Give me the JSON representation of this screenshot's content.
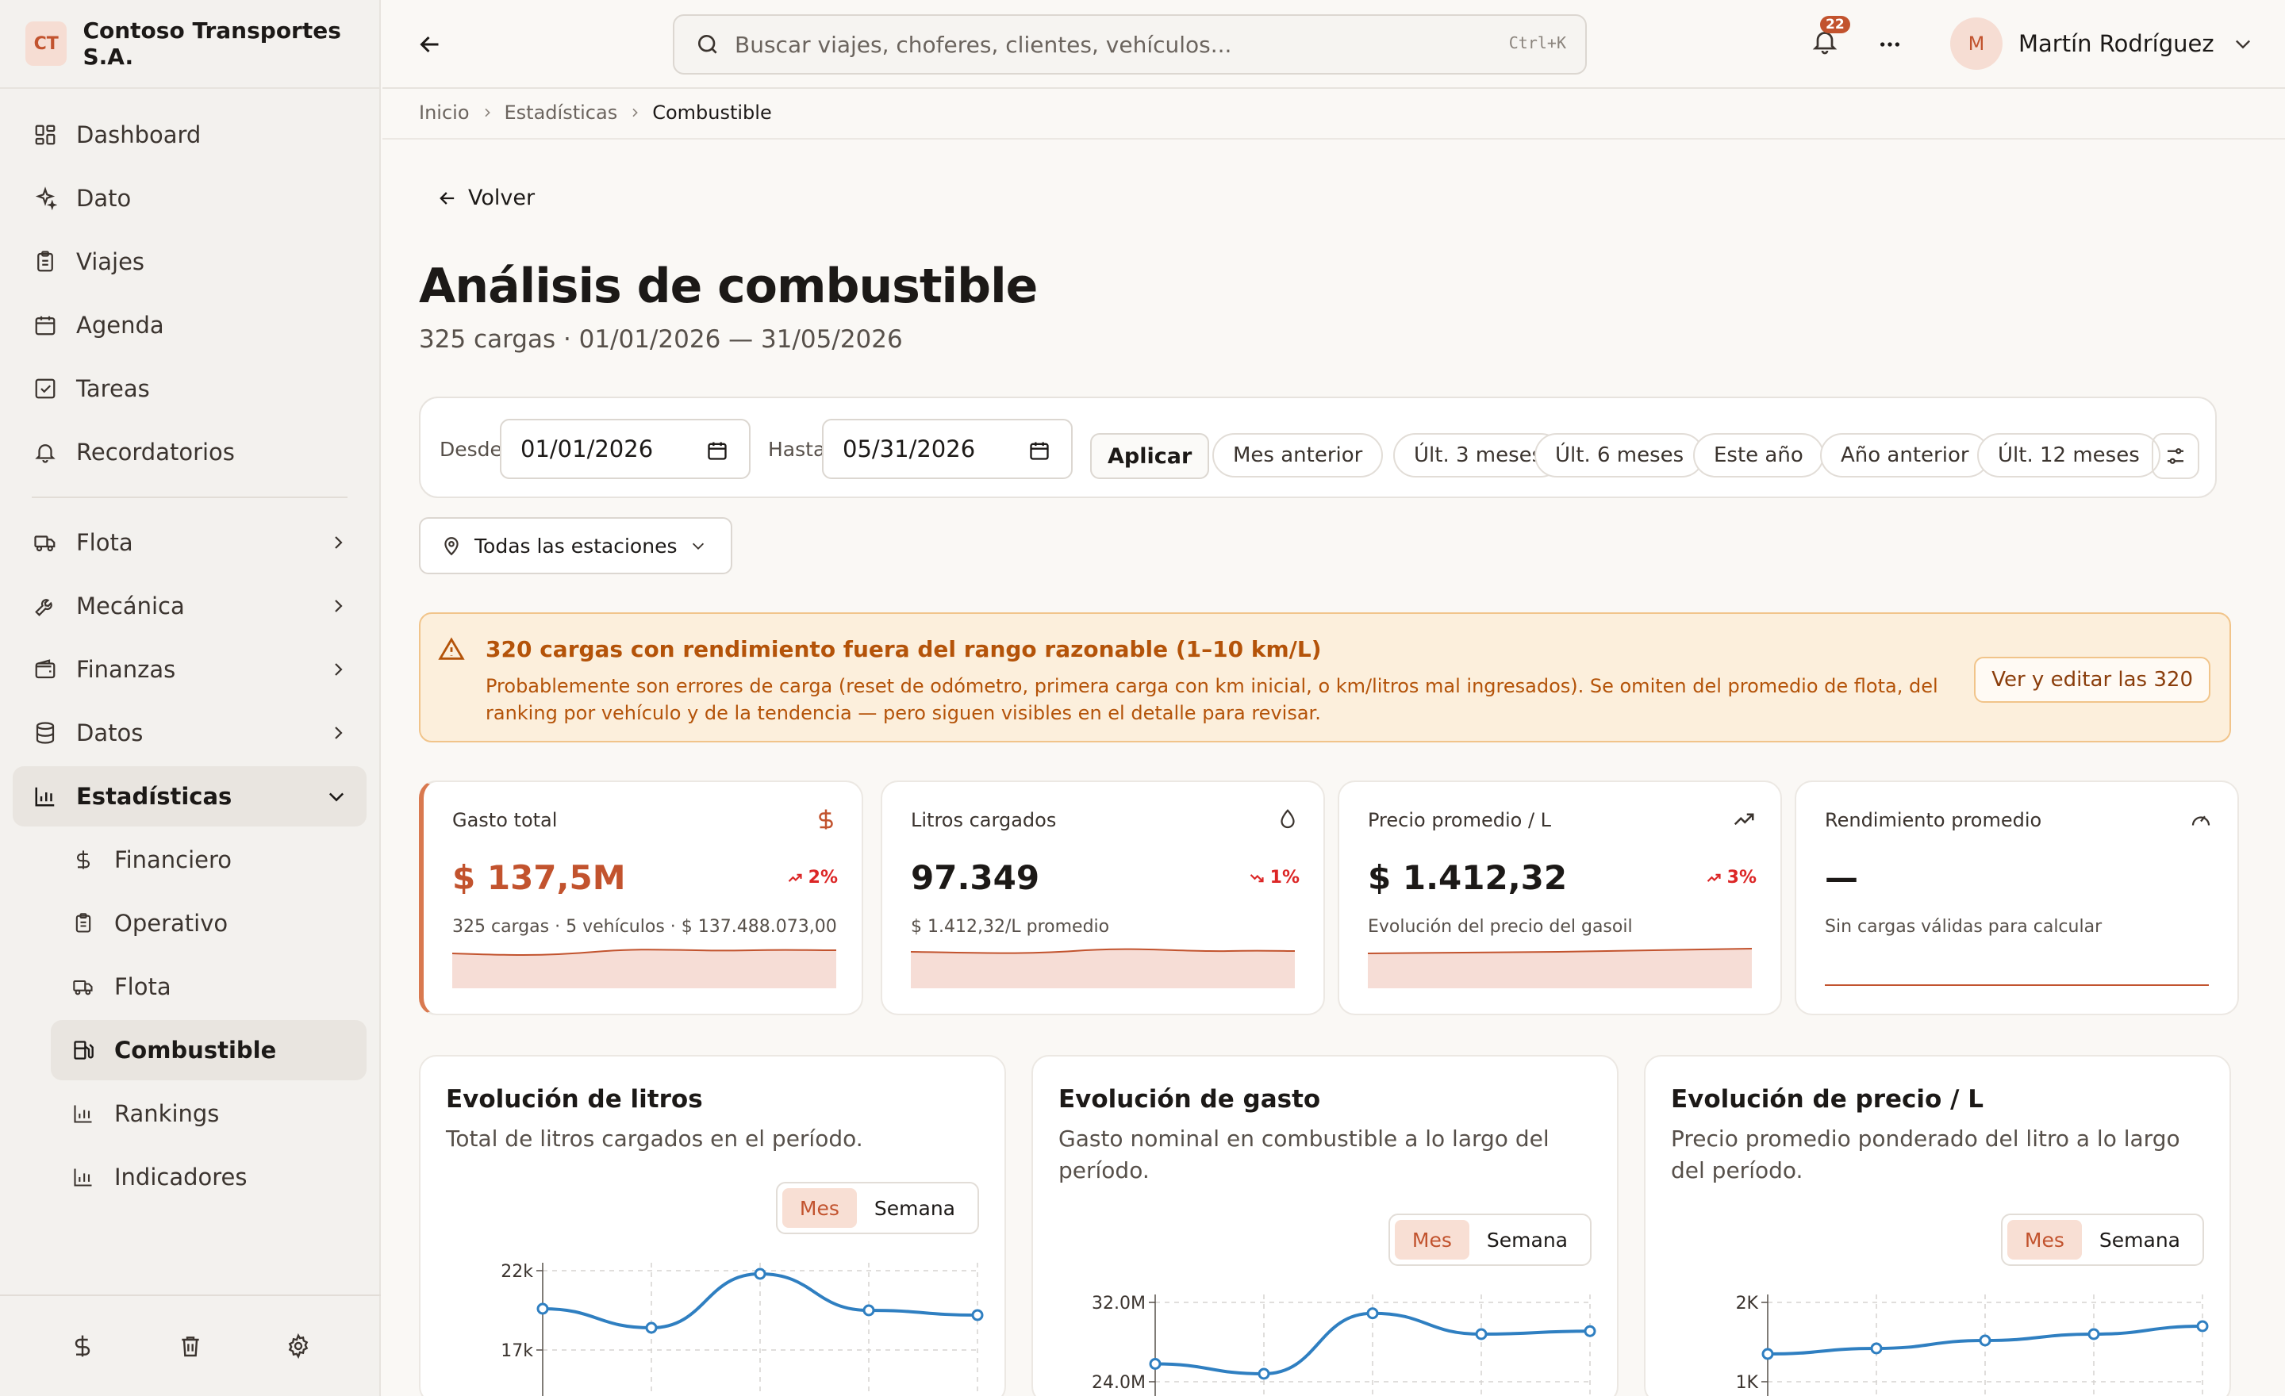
{
  "brand": {
    "logo": "CT",
    "name": "Contoso Transportes S.A."
  },
  "sidebar": {
    "items": [
      {
        "label": "Dashboard",
        "icon": "dashboard-icon"
      },
      {
        "label": "Dato",
        "icon": "sparkle-icon"
      },
      {
        "label": "Viajes",
        "icon": "clipboard-icon"
      },
      {
        "label": "Agenda",
        "icon": "calendar-icon"
      },
      {
        "label": "Tareas",
        "icon": "check-square-icon"
      },
      {
        "label": "Recordatorios",
        "icon": "bell-icon"
      }
    ],
    "groups": [
      {
        "label": "Flota",
        "icon": "truck-icon"
      },
      {
        "label": "Mecánica",
        "icon": "wrench-icon"
      },
      {
        "label": "Finanzas",
        "icon": "wallet-icon"
      },
      {
        "label": "Datos",
        "icon": "database-icon"
      },
      {
        "label": "Estadísticas",
        "icon": "bar-chart-icon"
      }
    ],
    "subitems": [
      {
        "label": "Financiero",
        "icon": "dollar-icon"
      },
      {
        "label": "Operativo",
        "icon": "clipboard-icon"
      },
      {
        "label": "Flota",
        "icon": "truck-icon"
      },
      {
        "label": "Combustible",
        "icon": "fuel-icon"
      },
      {
        "label": "Rankings",
        "icon": "bar-chart-icon"
      },
      {
        "label": "Indicadores",
        "icon": "bar-chart-icon"
      }
    ]
  },
  "topbar": {
    "search_placeholder": "Buscar viajes, choferes, clientes, vehículos...",
    "shortcut": "Ctrl+K",
    "notifications": "22",
    "user_initial": "M",
    "user_name": "Martín Rodríguez"
  },
  "breadcrumb": [
    "Inicio",
    "Estadísticas",
    "Combustible"
  ],
  "back_label": "Volver",
  "page": {
    "title": "Análisis de combustible",
    "subtitle": "325 cargas · 01/01/2026 — 31/05/2026"
  },
  "filters": {
    "from_label": "Desde",
    "from_value": "01/01/2026",
    "to_label": "Hasta",
    "to_value": "05/31/2026",
    "apply": "Aplicar",
    "chips": [
      "Mes anterior",
      "Últ. 3 meses",
      "Últ. 6 meses",
      "Este año",
      "Año anterior",
      "Últ. 12 meses"
    ],
    "station": "Todas las estaciones"
  },
  "alert": {
    "title": "320 cargas con rendimiento fuera del rango razonable (1–10 km/L)",
    "text": "Probablemente son errores de carga (reset de odómetro, primera carga con km inicial, o km/litros mal ingresados). Se omiten del promedio de flota, del ranking por vehículo y de la tendencia — pero siguen visibles en el detalle para revisar.",
    "button": "Ver y editar las 320"
  },
  "kpis": [
    {
      "label": "Gasto total",
      "value": "$ 137,5M",
      "delta": "2%",
      "sub": "325 cargas · 5 vehículos · $ 137.488.073,00",
      "icon": "dollar-icon",
      "trend": "up"
    },
    {
      "label": "Litros cargados",
      "value": "97.349",
      "delta": "1%",
      "sub": "$ 1.412,32/L promedio",
      "icon": "droplet-icon",
      "trend": "down"
    },
    {
      "label": "Precio promedio / L",
      "value": "$ 1.412,32",
      "delta": "3%",
      "sub": "Evolución del precio del gasoil",
      "icon": "trending-up-icon",
      "trend": "up"
    },
    {
      "label": "Rendimiento promedio",
      "value": "—",
      "delta": "",
      "sub": "Sin cargas válidas para calcular",
      "icon": "gauge-icon",
      "trend": ""
    }
  ],
  "panels": [
    {
      "title": "Evolución de litros",
      "desc": "Total de litros cargados en el período."
    },
    {
      "title": "Evolución de gasto",
      "desc": "Gasto nominal en combustible a lo largo del período."
    },
    {
      "title": "Evolución de precio / L",
      "desc": "Precio promedio ponderado del litro a lo largo del período."
    }
  ],
  "toggle": {
    "month": "Mes",
    "week": "Semana"
  },
  "colors": {
    "accent": "#c2532e",
    "line": "#2f7fc1",
    "warning": "#b45309",
    "negative": "#dc2626"
  },
  "chart_data": [
    {
      "type": "line",
      "title": "Evolución de litros",
      "ticks": [
        "22k",
        "17k"
      ],
      "values": [
        19600,
        18400,
        21800,
        19500,
        19200
      ]
    },
    {
      "type": "line",
      "title": "Evolución de gasto",
      "ticks": [
        "32.0M",
        "24.0M"
      ],
      "values": [
        25.8,
        24.8,
        30.9,
        28.8,
        29.1
      ]
    },
    {
      "type": "line",
      "title": "Evolución de precio / L",
      "ticks": [
        "2K",
        "1K"
      ],
      "values": [
        1350,
        1420,
        1520,
        1600,
        1700
      ]
    }
  ]
}
